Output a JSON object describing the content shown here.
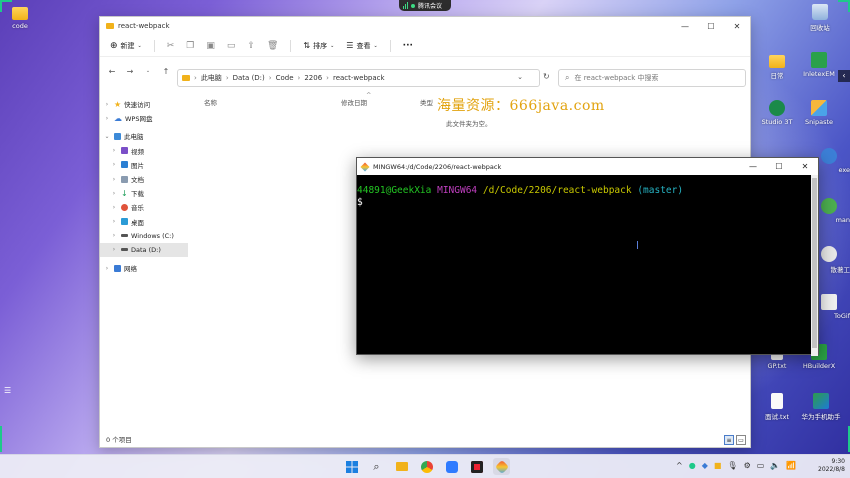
{
  "meeting": {
    "label": "腾讯会议"
  },
  "desktop": {
    "left_icon": {
      "label": "code"
    },
    "right_icons": [
      {
        "label": "回收站",
        "icon": "recycle-bin-icon"
      },
      {
        "label": "日常",
        "icon": "folder-icon"
      },
      {
        "label": "InletexEM",
        "icon": "app-icon"
      },
      {
        "label": "Studio 3T",
        "icon": "studio3t-icon"
      },
      {
        "label": "Snipaste",
        "icon": "snipaste-icon"
      },
      {
        "label": "exe",
        "icon": "app-icon"
      },
      {
        "label": "man",
        "icon": "app-icon"
      },
      {
        "label": "散著工",
        "icon": "app-icon"
      },
      {
        "label": "ToGif",
        "icon": "app-icon"
      },
      {
        "label": "GP.txt",
        "icon": "text-file-icon"
      },
      {
        "label": "HBuilderX",
        "icon": "hbuilderx-icon"
      },
      {
        "label": "面试.txt",
        "icon": "text-file-icon"
      },
      {
        "label": "华为手机助手",
        "icon": "huawei-icon"
      }
    ]
  },
  "explorer": {
    "title": "react-webpack",
    "controls": {
      "minimize": "—",
      "maximize": "☐",
      "close": "✕"
    },
    "toolbar": {
      "new_label": "新建",
      "sort_label": "排序",
      "view_label": "查看",
      "more_label": "···"
    },
    "breadcrumb": [
      "此电脑",
      "Data (D:)",
      "Code",
      "2206",
      "react-webpack"
    ],
    "search_placeholder": "在 react-webpack 中搜索",
    "nav": {
      "quick_access": "快速访问",
      "wps": "WPS网盘",
      "this_pc": "此电脑",
      "children": [
        "视频",
        "图片",
        "文档",
        "下载",
        "音乐",
        "桌面",
        "Windows (C:)",
        "Data (D:)"
      ],
      "network": "网络"
    },
    "columns": {
      "name": "名称",
      "date": "修改日期",
      "type": "类型"
    },
    "empty_message": "此文件夹为空。",
    "status": "0 个项目"
  },
  "watermark": "海量资源：666java.com",
  "terminal": {
    "title": "MINGW64:/d/Code/2206/react-webpack",
    "controls": {
      "minimize": "—",
      "maximize": "☐",
      "close": "✕"
    },
    "user_host": "44891@GeekXia",
    "system": "MINGW64",
    "path": "/d/Code/2206/react-webpack",
    "branch": "(master)",
    "prompt": "$"
  },
  "clock": {
    "time": "9:30",
    "date": "2022/8/8"
  },
  "colors": {
    "accent_green": "#1ec98a",
    "watermark": "#e2a30f",
    "terminal_bg": "#000000"
  }
}
